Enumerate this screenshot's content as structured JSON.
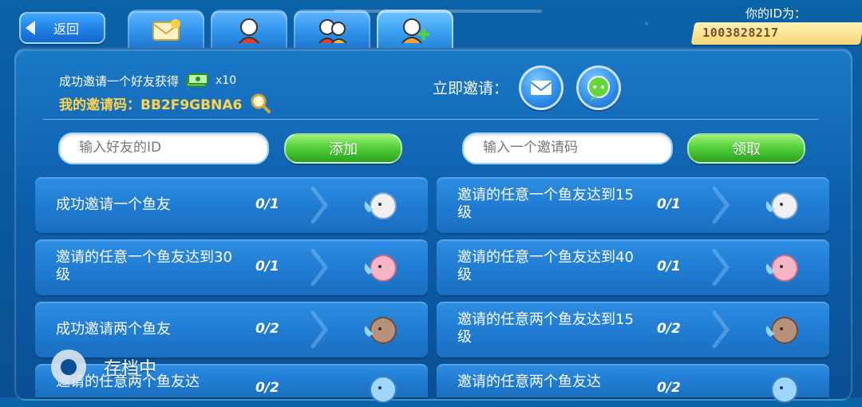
{
  "nav": {
    "back_label": "返回",
    "tabs": [
      {
        "name": "mail-tab",
        "icon": "mail-icon",
        "active": false
      },
      {
        "name": "single-friend-tab",
        "icon": "single-friend-icon",
        "active": false
      },
      {
        "name": "two-friends-tab",
        "icon": "two-friends-icon",
        "active": false
      },
      {
        "name": "add-friend-tab",
        "icon": "add-friend-icon",
        "active": true
      }
    ]
  },
  "profile": {
    "id_label": "你的ID为：",
    "id_value": "1003828217"
  },
  "invite": {
    "reward_text": "成功邀请一个好友获得",
    "reward_multiplier": "x10",
    "code_label": "我的邀请码：",
    "code_value": "BB2F9GBNA6",
    "invite_now_label": "立即邀请："
  },
  "actions": {
    "friend_id_placeholder": "输入好友的ID",
    "add_label": "添加",
    "invite_code_placeholder": "输入一个邀请码",
    "claim_label": "领取"
  },
  "tasks": [
    {
      "label": "成功邀请一个鱼友",
      "progress": "0/1",
      "fish": "fish-icon-white"
    },
    {
      "label": "邀请的任意一个鱼友达到15级",
      "progress": "0/1",
      "fish": "fish-icon-white"
    },
    {
      "label": "邀请的任意一个鱼友达到30级",
      "progress": "0/1",
      "fish": "fish-icon-pink"
    },
    {
      "label": "邀请的任意一个鱼友达到40级",
      "progress": "0/1",
      "fish": "fish-icon-pink"
    },
    {
      "label": "成功邀请两个鱼友",
      "progress": "0/2",
      "fish": "fish-icon-brown"
    },
    {
      "label": "邀请的任意两个鱼友达到15级",
      "progress": "0/2",
      "fish": "fish-icon-brown"
    },
    {
      "label": "邀请的任意两个鱼友达",
      "progress": "0/2",
      "fish": "fish-icon-blue"
    },
    {
      "label": "邀请的任意两个鱼友达",
      "progress": "0/2",
      "fish": "fish-icon-blue"
    }
  ],
  "overlay": {
    "saving_text": "存档中"
  },
  "colors": {
    "accent_yellow": "#ffd34a",
    "green_button": "#56d23a",
    "panel_blue": "#0c5eaa"
  }
}
